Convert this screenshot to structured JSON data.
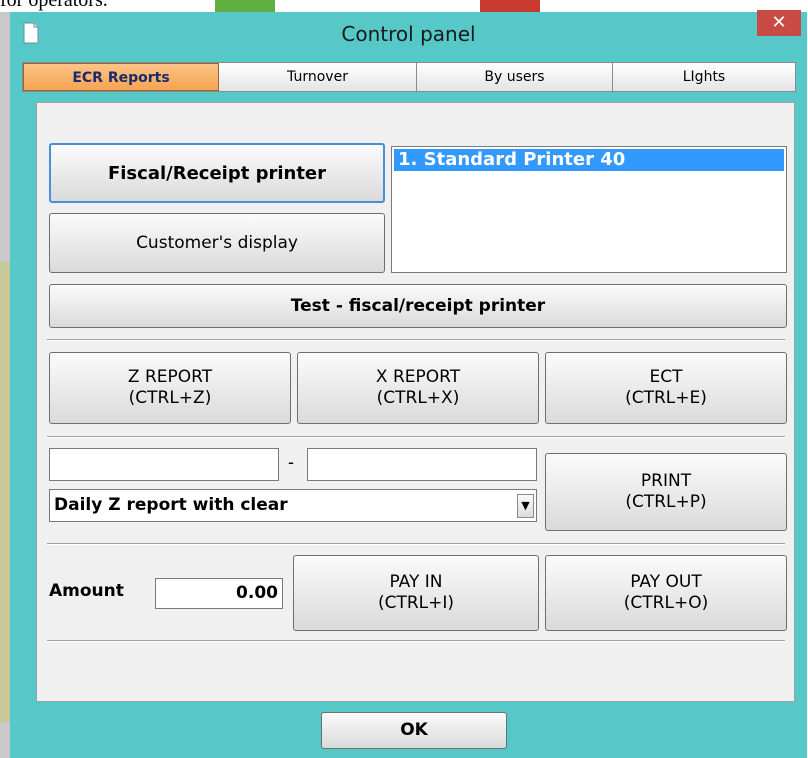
{
  "page_fragment_text": "for operators.",
  "window": {
    "title": "Control panel",
    "close_label": "✕"
  },
  "tabs": [
    {
      "label": "ECR Reports",
      "active": true
    },
    {
      "label": "Turnover",
      "active": false
    },
    {
      "label": "By users",
      "active": false
    },
    {
      "label": "LIghts",
      "active": false
    }
  ],
  "devices": {
    "fiscal_printer_label": "Fiscal/Receipt printer",
    "customer_display_label": "Customer's display",
    "printer_list": [
      "1.  Standard Printer 40"
    ],
    "test_label": "Test - fiscal/receipt printer"
  },
  "reports": {
    "z_report": {
      "line1": "Z REPORT",
      "line2": "(CTRL+Z)"
    },
    "x_report": {
      "line1": "X REPORT",
      "line2": "(CTRL+X)"
    },
    "ect": {
      "line1": "ECT",
      "line2": "(CTRL+E)"
    }
  },
  "print_section": {
    "range_from_value": "",
    "range_separator": "-",
    "range_to_value": "",
    "report_type_selected": "Daily Z report with clear",
    "print_button": {
      "line1": "PRINT",
      "line2": "(CTRL+P)"
    }
  },
  "cash": {
    "amount_label": "Amount",
    "amount_value": "0.00",
    "pay_in": {
      "line1": "PAY IN",
      "line2": "(CTRL+I)"
    },
    "pay_out": {
      "line1": "PAY OUT",
      "line2": "(CTRL+O)"
    }
  },
  "ok_label": "OK",
  "colors": {
    "titlebar": "#56c8c8",
    "active_tab": "#f5a452",
    "list_selection": "#3399ff",
    "close_button": "#c84a45"
  }
}
